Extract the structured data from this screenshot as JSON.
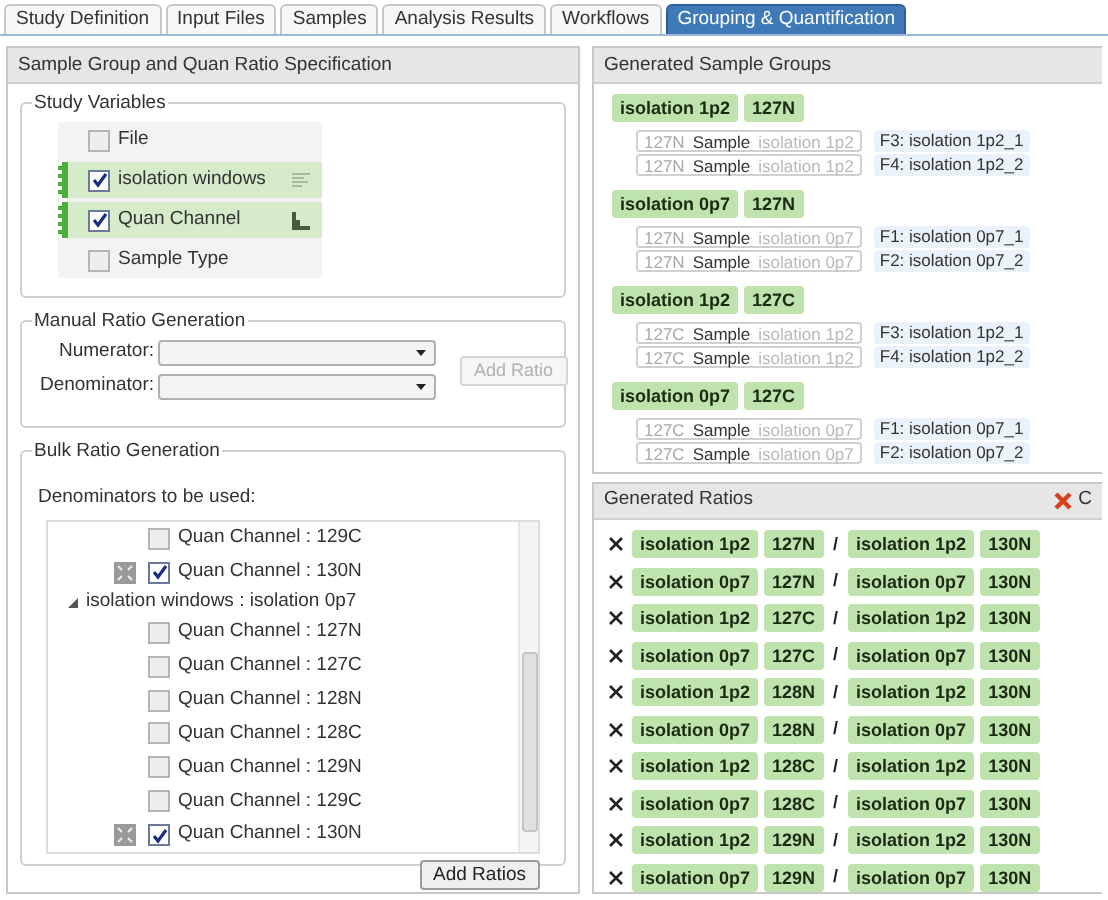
{
  "tabs": [
    {
      "label": "Study Definition",
      "selected": false
    },
    {
      "label": "Input Files",
      "selected": false
    },
    {
      "label": "Samples",
      "selected": false
    },
    {
      "label": "Analysis Results",
      "selected": false
    },
    {
      "label": "Workflows",
      "selected": false
    },
    {
      "label": "Grouping & Quantification",
      "selected": true
    }
  ],
  "left_panel": {
    "title": "Sample Group and Quan Ratio Specification",
    "study_variables": {
      "legend": "Study Variables",
      "items": [
        {
          "label": "File",
          "checked": false,
          "kind": "plain"
        },
        {
          "label": "isolation windows",
          "checked": true,
          "kind": "row-group"
        },
        {
          "label": "Quan Channel",
          "checked": true,
          "kind": "column-group"
        },
        {
          "label": "Sample Type",
          "checked": false,
          "kind": "plain"
        }
      ]
    },
    "manual_ratio": {
      "legend": "Manual Ratio Generation",
      "numerator_label": "Numerator:",
      "denominator_label": "Denominator:",
      "button": {
        "label": "Add Ratio",
        "disabled": true
      }
    },
    "bulk_ratio": {
      "legend": "Bulk Ratio Generation",
      "caption": "Denominators to be used:",
      "tree": [
        {
          "label": "Quan Channel : 129C",
          "checked": false,
          "pinned": false
        },
        {
          "label": "Quan Channel : 130N",
          "checked": true,
          "pinned": true
        },
        {
          "label": "isolation windows : isolation 0p7",
          "expanded": true,
          "children": [
            {
              "label": "Quan Channel : 127N",
              "checked": false,
              "pinned": false
            },
            {
              "label": "Quan Channel : 127C",
              "checked": false,
              "pinned": false
            },
            {
              "label": "Quan Channel : 128N",
              "checked": false,
              "pinned": false
            },
            {
              "label": "Quan Channel : 128C",
              "checked": false,
              "pinned": false
            },
            {
              "label": "Quan Channel : 129N",
              "checked": false,
              "pinned": false
            },
            {
              "label": "Quan Channel : 129C",
              "checked": false,
              "pinned": false
            },
            {
              "label": "Quan Channel : 130N",
              "checked": true,
              "pinned": true
            }
          ]
        }
      ],
      "button": {
        "label": "Add Ratios",
        "disabled": false
      }
    }
  },
  "sample_groups": {
    "title": "Generated Sample Groups",
    "groups": [
      {
        "tags": [
          "isolation 1p2",
          "127N"
        ],
        "samples": [
          {
            "channel": "127N",
            "label": "Sample",
            "isolation": "isolation 1p2",
            "file": "F3: isolation 1p2_1"
          },
          {
            "channel": "127N",
            "label": "Sample",
            "isolation": "isolation 1p2",
            "file": "F4: isolation 1p2_2"
          }
        ]
      },
      {
        "tags": [
          "isolation 0p7",
          "127N"
        ],
        "samples": [
          {
            "channel": "127N",
            "label": "Sample",
            "isolation": "isolation 0p7",
            "file": "F1: isolation 0p7_1"
          },
          {
            "channel": "127N",
            "label": "Sample",
            "isolation": "isolation 0p7",
            "file": "F2: isolation 0p7_2"
          }
        ]
      },
      {
        "tags": [
          "isolation 1p2",
          "127C"
        ],
        "samples": [
          {
            "channel": "127C",
            "label": "Sample",
            "isolation": "isolation 1p2",
            "file": "F3: isolation 1p2_1"
          },
          {
            "channel": "127C",
            "label": "Sample",
            "isolation": "isolation 1p2",
            "file": "F4: isolation 1p2_2"
          }
        ]
      },
      {
        "tags": [
          "isolation 0p7",
          "127C"
        ],
        "samples": [
          {
            "channel": "127C",
            "label": "Sample",
            "isolation": "isolation 0p7",
            "file": "F1: isolation 0p7_1"
          },
          {
            "channel": "127C",
            "label": "Sample",
            "isolation": "isolation 0p7",
            "file": "F2: isolation 0p7_2"
          }
        ]
      }
    ]
  },
  "generated_ratios": {
    "title": "Generated Ratios",
    "clear_button": "C",
    "rows": [
      {
        "numerator": [
          "isolation 1p2",
          "127N"
        ],
        "separator": "/",
        "denominator": [
          "isolation 1p2",
          "130N"
        ]
      },
      {
        "numerator": [
          "isolation 0p7",
          "127N"
        ],
        "separator": "/",
        "denominator": [
          "isolation 0p7",
          "130N"
        ]
      },
      {
        "numerator": [
          "isolation 1p2",
          "127C"
        ],
        "separator": "/",
        "denominator": [
          "isolation 1p2",
          "130N"
        ]
      },
      {
        "numerator": [
          "isolation 0p7",
          "127C"
        ],
        "separator": "/",
        "denominator": [
          "isolation 0p7",
          "130N"
        ]
      },
      {
        "numerator": [
          "isolation 1p2",
          "128N"
        ],
        "separator": "/",
        "denominator": [
          "isolation 1p2",
          "130N"
        ]
      },
      {
        "numerator": [
          "isolation 0p7",
          "128N"
        ],
        "separator": "/",
        "denominator": [
          "isolation 0p7",
          "130N"
        ]
      },
      {
        "numerator": [
          "isolation 1p2",
          "128C"
        ],
        "separator": "/",
        "denominator": [
          "isolation 1p2",
          "130N"
        ]
      },
      {
        "numerator": [
          "isolation 0p7",
          "128C"
        ],
        "separator": "/",
        "denominator": [
          "isolation 0p7",
          "130N"
        ]
      },
      {
        "numerator": [
          "isolation 1p2",
          "129N"
        ],
        "separator": "/",
        "denominator": [
          "isolation 1p2",
          "130N"
        ]
      },
      {
        "numerator": [
          "isolation 0p7",
          "129N"
        ],
        "separator": "/",
        "denominator": [
          "isolation 0p7",
          "130N"
        ]
      }
    ]
  }
}
